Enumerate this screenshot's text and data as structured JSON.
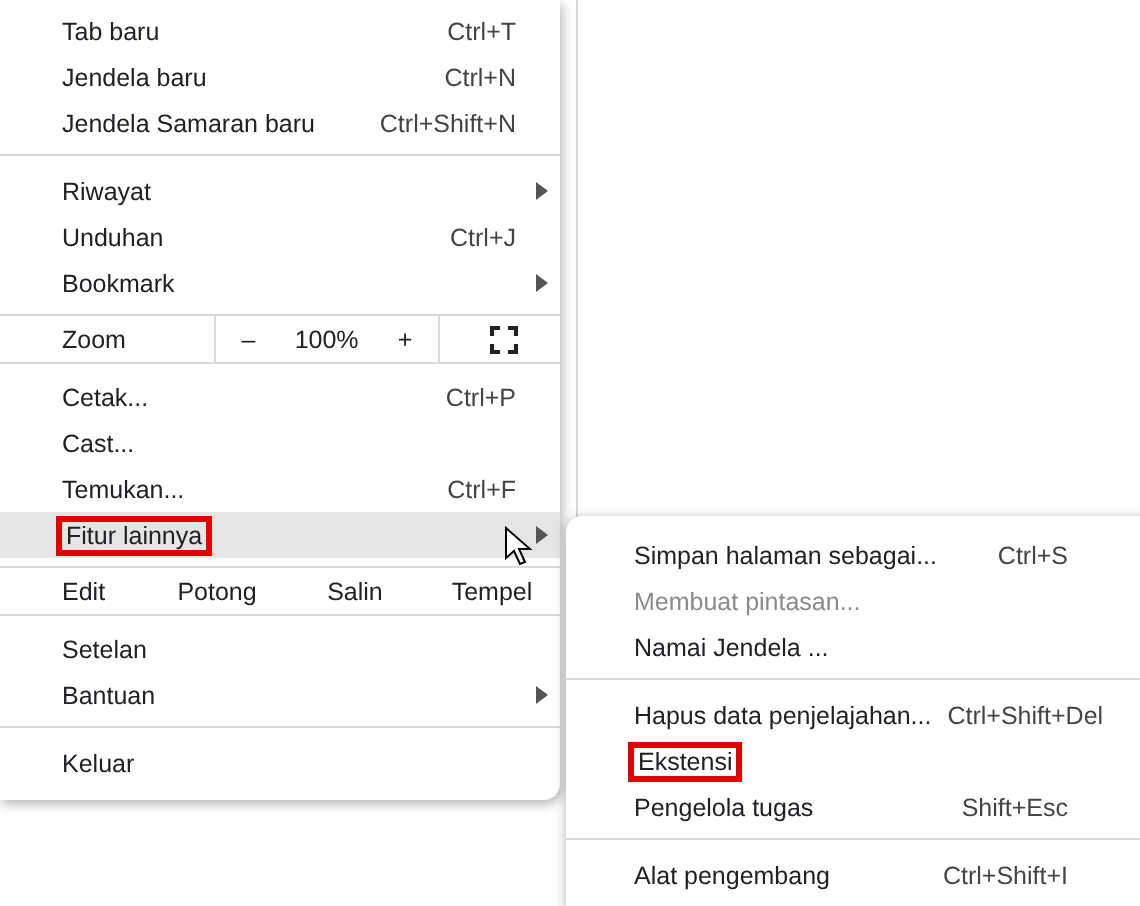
{
  "menu": {
    "rows": [
      {
        "kind": "item",
        "label": "Tab baru",
        "shortcut": "Ctrl+T"
      },
      {
        "kind": "item",
        "label": "Jendela baru",
        "shortcut": "Ctrl+N"
      },
      {
        "kind": "item",
        "label": "Jendela Samaran baru",
        "shortcut": "Ctrl+Shift+N"
      },
      {
        "kind": "divider"
      },
      {
        "kind": "submenu",
        "label": "Riwayat"
      },
      {
        "kind": "item",
        "label": "Unduhan",
        "shortcut": "Ctrl+J"
      },
      {
        "kind": "submenu",
        "label": "Bookmark"
      },
      {
        "kind": "zoom",
        "label": "Zoom",
        "minus": "–",
        "value": "100%",
        "plus": "+"
      },
      {
        "kind": "item",
        "label": "Cetak...",
        "shortcut": "Ctrl+P"
      },
      {
        "kind": "item",
        "label": "Cast..."
      },
      {
        "kind": "item",
        "label": "Temukan...",
        "shortcut": "Ctrl+F"
      },
      {
        "kind": "submenu",
        "label": "Fitur lainnya",
        "selected": true,
        "highlighted": true
      },
      {
        "kind": "edit",
        "label": "Edit",
        "actions": [
          "Potong",
          "Salin",
          "Tempel"
        ]
      },
      {
        "kind": "item",
        "label": "Setelan"
      },
      {
        "kind": "submenu",
        "label": "Bantuan"
      },
      {
        "kind": "divider"
      },
      {
        "kind": "item",
        "label": "Keluar"
      }
    ]
  },
  "submenu": {
    "rows": [
      {
        "kind": "item",
        "label": "Simpan halaman sebagai...",
        "shortcut": "Ctrl+S"
      },
      {
        "kind": "item",
        "label": "Membuat pintasan...",
        "disabled": true
      },
      {
        "kind": "item",
        "label": "Namai Jendela ..."
      },
      {
        "kind": "divider"
      },
      {
        "kind": "item",
        "label": "Hapus data penjelajahan...",
        "shortcut": "Ctrl+Shift+Del"
      },
      {
        "kind": "item",
        "label": "Ekstensi",
        "highlighted": true
      },
      {
        "kind": "item",
        "label": "Pengelola tugas",
        "shortcut": "Shift+Esc"
      },
      {
        "kind": "divider"
      },
      {
        "kind": "item",
        "label": "Alat pengembang",
        "shortcut": "Ctrl+Shift+I"
      }
    ]
  }
}
